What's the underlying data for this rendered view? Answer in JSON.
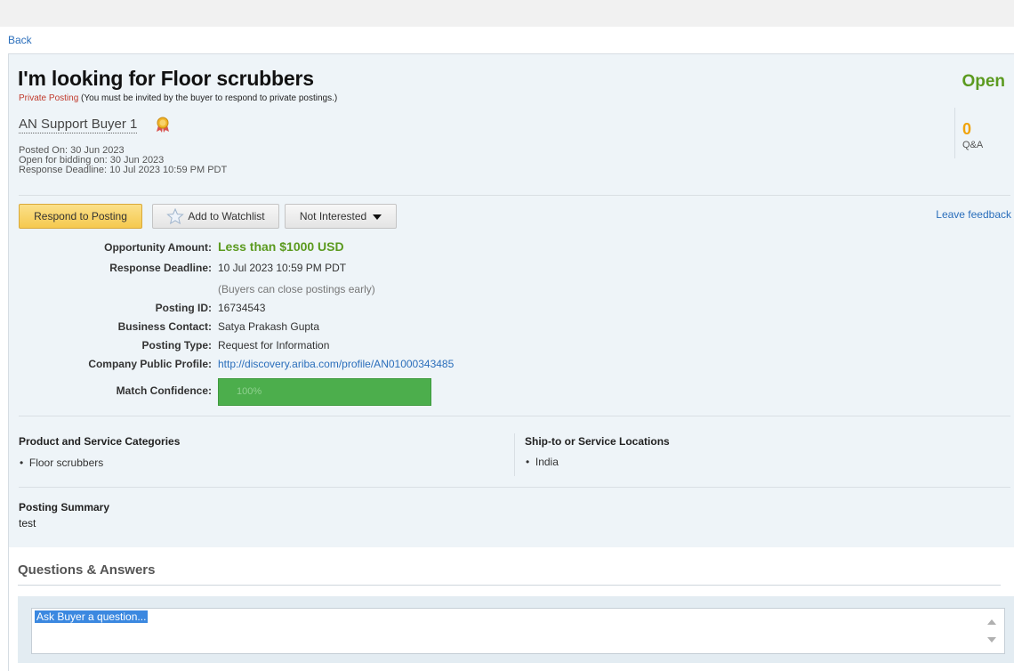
{
  "nav": {
    "back_label": "Back"
  },
  "posting": {
    "title": "I'm looking for Floor scrubbers",
    "private_label": "Private Posting",
    "private_note": " (You must be invited by the buyer to respond to private postings.)",
    "buyer_name": "AN Support Buyer 1",
    "posted_on": "Posted On:  30 Jun 2023",
    "open_for_bidding": "Open for bidding on:  30 Jun 2023",
    "response_deadline_line": "Response Deadline:  10 Jul 2023 10:59 PM PDT",
    "status": "Open",
    "qa_count": "0",
    "qa_label": "Q&A"
  },
  "actions": {
    "respond_label": "Respond to Posting",
    "watchlist_label": "Add to Watchlist",
    "not_interested_label": "Not Interested",
    "leave_feedback_label": "Leave feedback"
  },
  "details": {
    "amount_label": "Opportunity Amount:",
    "amount_value": "Less than $1000 USD",
    "deadline_label": "Response Deadline:",
    "deadline_value": "10 Jul 2023 10:59 PM PDT",
    "deadline_note": "(Buyers can close postings early)",
    "posting_id_label": "Posting ID:",
    "posting_id_value": "16734543",
    "contact_label": "Business Contact:",
    "contact_value": "Satya Prakash Gupta",
    "type_label": "Posting Type:",
    "type_value": "Request for Information",
    "profile_label": "Company Public Profile:",
    "profile_value": "http://discovery.ariba.com/profile/AN01000343485",
    "match_label": "Match Confidence:",
    "match_value": "100%",
    "match_fraction": 1.0
  },
  "categories": {
    "label": "Product and Service Categories",
    "items": [
      "Floor scrubbers"
    ]
  },
  "locations": {
    "label": "Ship-to or Service Locations",
    "items": [
      "India"
    ]
  },
  "summary": {
    "label": "Posting Summary",
    "text": "test"
  },
  "qa": {
    "title": "Questions & Answers",
    "input_value": "Ask Buyer a question..."
  },
  "colors": {
    "open_status": "#5b9a1f",
    "qa_count": "#f0a30a",
    "private_posting": "#c0392b",
    "match_bar": "#4cae4c",
    "link": "#2a6ebb"
  }
}
